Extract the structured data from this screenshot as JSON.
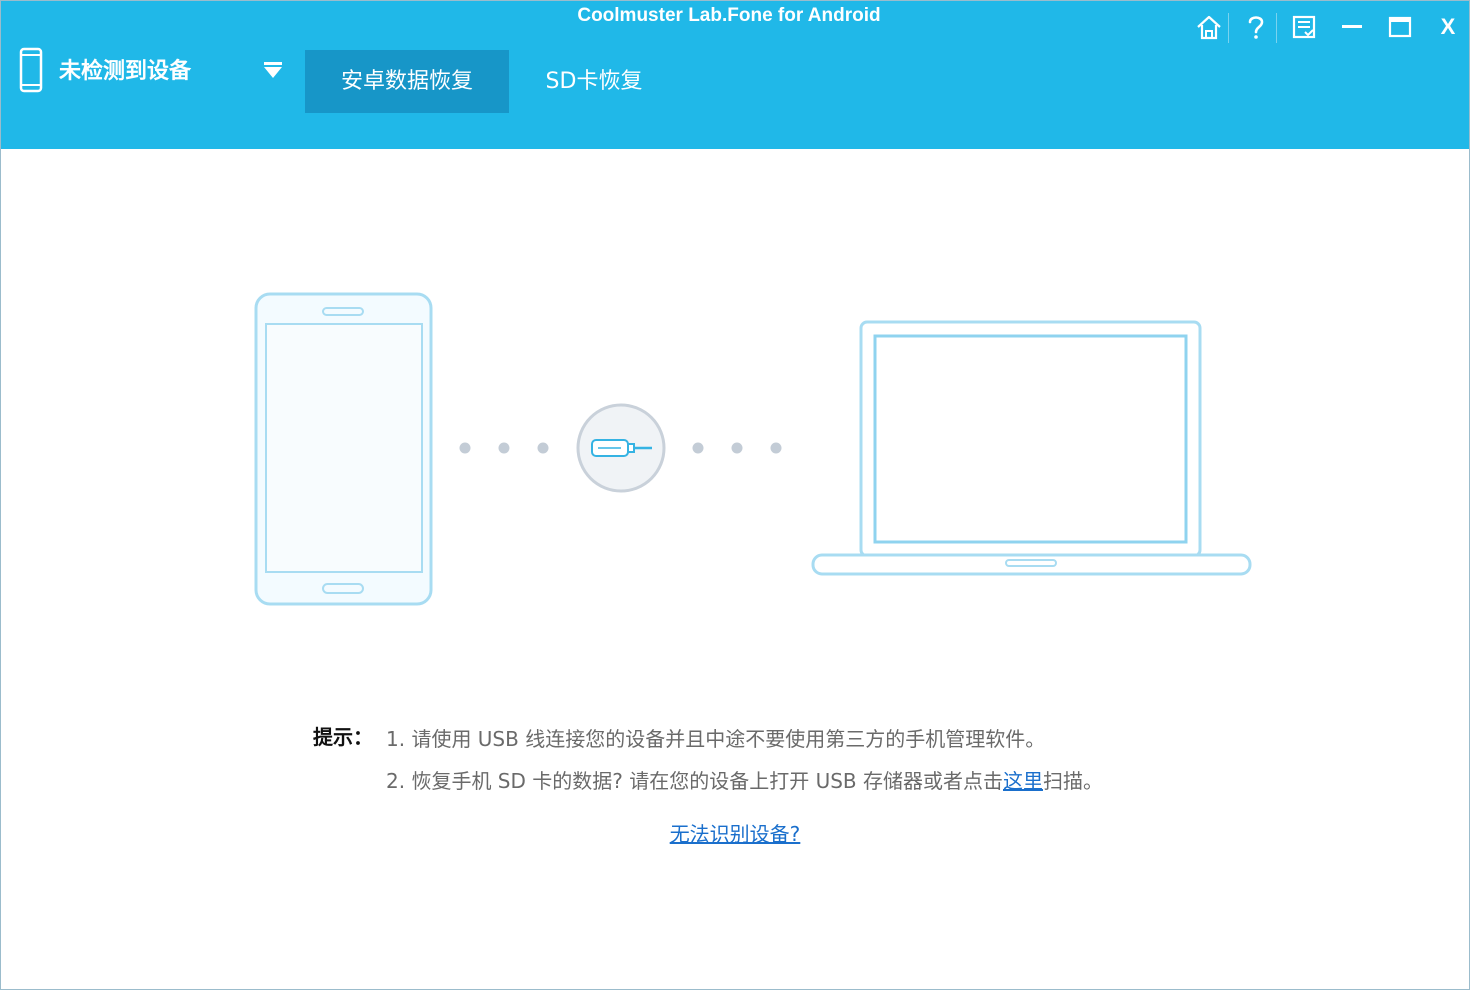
{
  "window": {
    "title": "Coolmuster Lab.Fone for Android"
  },
  "header": {
    "device_status": "未检测到设备",
    "tabs": [
      {
        "label": "安卓数据恢复",
        "active": true
      },
      {
        "label": "SD卡恢复",
        "active": false
      }
    ]
  },
  "window_controls": [
    {
      "name": "home-icon"
    },
    {
      "name": "help-icon"
    },
    {
      "name": "feedback-icon"
    },
    {
      "name": "minimize-icon"
    },
    {
      "name": "maximize-icon"
    },
    {
      "name": "close-icon",
      "label": "X"
    }
  ],
  "tips": {
    "label": "提示：",
    "line1": "1. 请使用 USB 线连接您的设备并且中途不要使用第三方的手机管理软件。",
    "line2_before": "2. 恢复手机 SD 卡的数据? 请在您的设备上打开 USB 存储器或者点击",
    "line2_link": "这里",
    "line2_after": "扫描。"
  },
  "help_link": "无法识别设备?",
  "colors": {
    "header_bg": "#20b8e8",
    "active_tab_bg": "#1796c8",
    "device_outline": "#a8dcf2",
    "link": "#1a6fcc"
  }
}
